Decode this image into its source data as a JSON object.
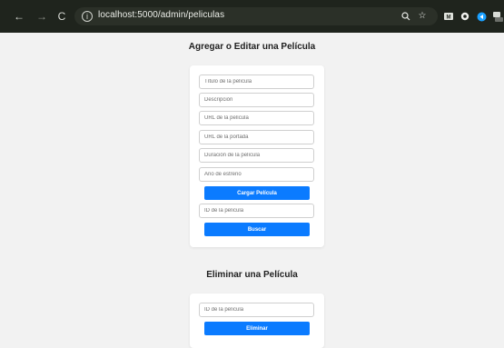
{
  "browser": {
    "url": "localhost:5000/admin/peliculas",
    "nav": {
      "back": "←",
      "forward": "→",
      "reload": "C"
    },
    "icons": [
      "search-icon",
      "star-icon",
      "extension-m-icon",
      "extension-circle-icon",
      "extension-blue-icon",
      "extension-off-icon",
      "extensions-puzzle-icon",
      "reading-list-icon",
      "profile-avatar-icon",
      "menu-dots-icon"
    ]
  },
  "edit_section": {
    "title": "Agregar o Editar una Película",
    "placeholders": {
      "title": "Título de la película",
      "description": "Descripción",
      "movie_url": "URL de la película",
      "cover_url": "URL de la portada",
      "duration": "Duración de la película",
      "year": "Año de estreno",
      "movie_id": "ID de la película"
    },
    "submit_label": "Cargar Película",
    "search_label": "Buscar"
  },
  "delete_section": {
    "title": "Eliminar una Película",
    "id_placeholder": "ID de la película",
    "delete_label": "Eliminar"
  },
  "colors": {
    "primary": "#0b7bff",
    "page_background": "#f2f2f2",
    "card_background": "#ffffff",
    "browser_toolbar": "#1f241d"
  }
}
